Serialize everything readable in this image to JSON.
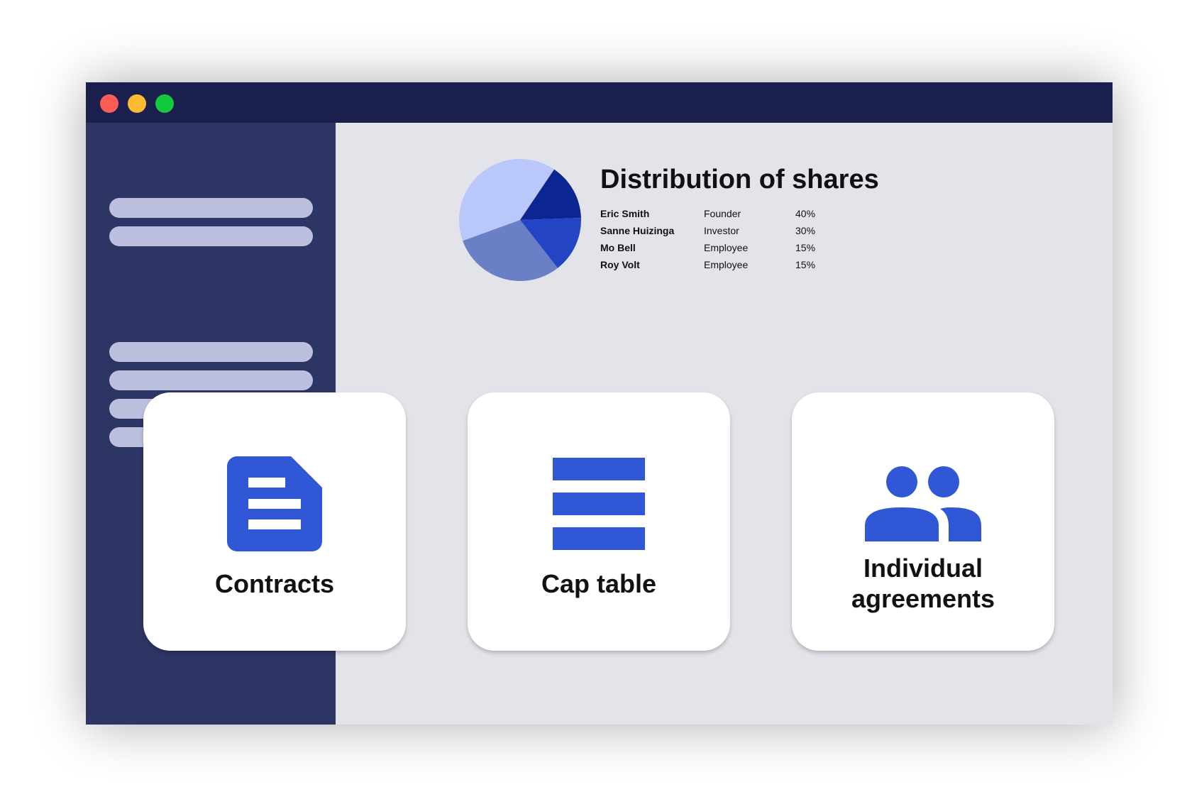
{
  "window": {
    "buttons": [
      {
        "name": "close",
        "color": "#fd5d57"
      },
      {
        "name": "minimize",
        "color": "#fdb930"
      },
      {
        "name": "maximize",
        "color": "#13c93e"
      }
    ]
  },
  "sidebar": {
    "bar_color": "#bdbfde",
    "background": "#2d3565"
  },
  "distribution": {
    "title": "Distribution of shares",
    "shareholders": [
      {
        "name": "Eric Smith",
        "role": "Founder",
        "percent": "40%"
      },
      {
        "name": "Sanne Huizinga",
        "role": "Investor",
        "percent": "30%"
      },
      {
        "name": "Mo Bell",
        "role": "Employee",
        "percent": "15%"
      },
      {
        "name": "Roy Volt",
        "role": "Employee",
        "percent": "15%"
      }
    ]
  },
  "chart_data": {
    "type": "pie",
    "categories": [
      "Eric Smith",
      "Sanne Huizinga",
      "Mo Bell",
      "Roy Volt"
    ],
    "values": [
      40,
      30,
      15,
      15
    ],
    "colors": [
      "#b9c7fa",
      "#6b7fc7",
      "#2445c3",
      "#0b2692"
    ]
  },
  "cards": [
    {
      "label": "Contracts",
      "icon": "document-icon"
    },
    {
      "label": "Cap table",
      "icon": "list-icon"
    },
    {
      "label": "Individual agreements",
      "label_line1": "Individual",
      "label_line2": "agreements",
      "icon": "people-icon"
    }
  ],
  "accent_color": "#2f57d6"
}
